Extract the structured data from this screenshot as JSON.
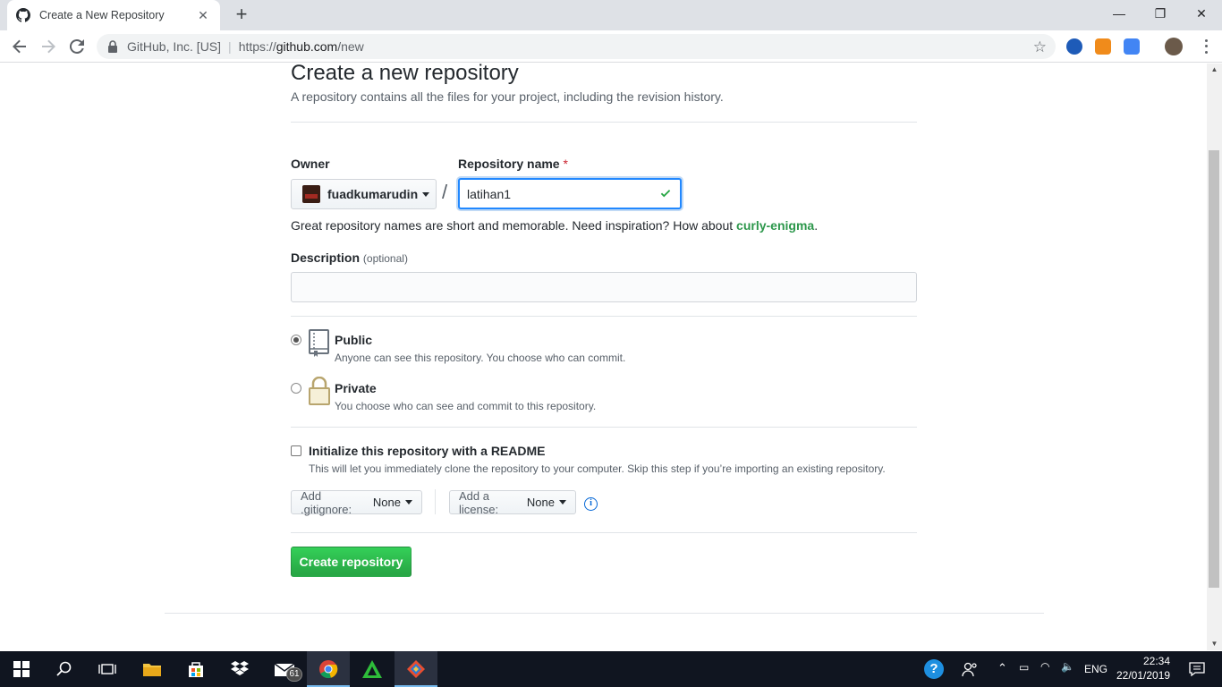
{
  "browser": {
    "tab_title": "Create a New Repository",
    "tab_close": "✕",
    "new_tab": "+",
    "site_org": "GitHub, Inc. [US]",
    "url_prefix": "https://",
    "url_host": "github.com",
    "url_path": "/new",
    "win_min": "—",
    "win_max": "❐",
    "win_close": "✕"
  },
  "page": {
    "title": "Create a new repository",
    "subtitle": "A repository contains all the files for your project, including the revision history.",
    "owner_label": "Owner",
    "repo_label": "Repository name",
    "required_mark": "*",
    "owner_value": "fuadkumarudin",
    "slash": "/",
    "repo_value": "latihan1",
    "hint_text": "Great repository names are short and memorable. Need inspiration? How about ",
    "hint_suggestion": "curly-enigma",
    "hint_end": ".",
    "desc_label": "Description",
    "desc_optional": "(optional)",
    "desc_value": "",
    "visibility": {
      "selected": "public",
      "public_title": "Public",
      "public_note": "Anyone can see this repository. You choose who can commit.",
      "private_title": "Private",
      "private_note": "You choose who can see and commit to this repository."
    },
    "readme_label": "Initialize this repository with a README",
    "readme_checked": false,
    "readme_note": "This will let you immediately clone the repository to your computer. Skip this step if you’re importing an existing repository.",
    "gitignore_label": "Add .gitignore:",
    "gitignore_value": "None",
    "license_label": "Add a license:",
    "license_value": "None",
    "info_glyph": "i",
    "create_button": "Create repository"
  },
  "taskbar": {
    "mail_badge": "61",
    "lang": "ENG",
    "time": "22:34",
    "date": "22/01/2019"
  },
  "colors": {
    "accent_blue": "#0366d6",
    "create_green": "#28a745",
    "check_green": "#28a745",
    "required_red": "#cb2431"
  }
}
